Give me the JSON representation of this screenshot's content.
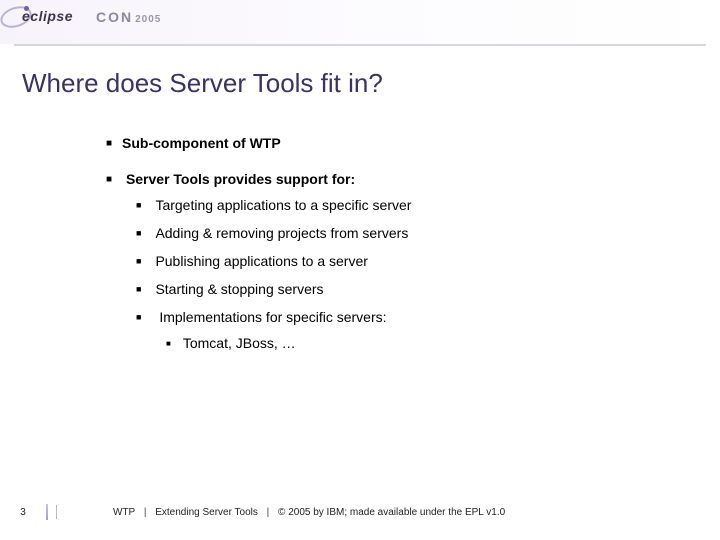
{
  "header": {
    "logo_text": "eclipse",
    "conference": "CON",
    "year": "2005"
  },
  "title": "Where does Server Tools fit in?",
  "bullets": {
    "b1": "Sub-component of WTP",
    "b2": "Server Tools provides support for:",
    "b2_1": "Targeting applications to a specific server",
    "b2_2": "Adding & removing projects from servers",
    "b2_3": "Publishing applications to a server",
    "b2_4": "Starting & stopping servers",
    "b2_5": "Implementations for specific servers:",
    "b2_5_1": "Tomcat, JBoss, …"
  },
  "footer": {
    "page": "3",
    "project": "WTP",
    "talk": "Extending Server Tools",
    "copyright": "© 2005 by IBM; made available under the EPL v1.0"
  }
}
